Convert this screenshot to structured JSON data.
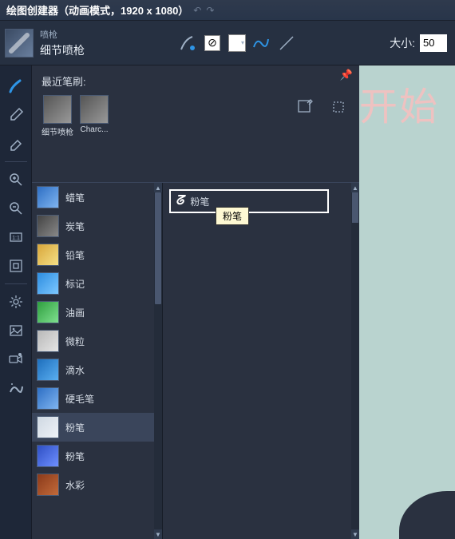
{
  "titlebar": {
    "title": "绘图创建器（动画模式，1920 x 1080）"
  },
  "toolbar": {
    "brush_category": "喷枪",
    "brush_name": "细节喷枪",
    "size_label": "大小:",
    "size_value": "50"
  },
  "panel": {
    "recent_label": "最近笔刷:",
    "recent_items": [
      {
        "name": "细节喷枪"
      },
      {
        "name": "Charc..."
      }
    ]
  },
  "categories": [
    {
      "label": "蜡笔",
      "thumb_bg": "linear-gradient(135deg,#2e6fc4,#7fb4f0)"
    },
    {
      "label": "炭笔",
      "thumb_bg": "linear-gradient(135deg,#444,#888)"
    },
    {
      "label": "铅笔",
      "thumb_bg": "linear-gradient(135deg,#d8a63a,#f5e086)"
    },
    {
      "label": "标记",
      "thumb_bg": "linear-gradient(135deg,#2d8de0,#7cc7ff)"
    },
    {
      "label": "油画",
      "thumb_bg": "linear-gradient(135deg,#2f9f3f,#7fe08f)"
    },
    {
      "label": "微粒",
      "thumb_bg": "linear-gradient(135deg,#b8b8b8,#e5e5e5)"
    },
    {
      "label": "滴水",
      "thumb_bg": "linear-gradient(135deg,#1e6fbd,#5aaef0)"
    },
    {
      "label": "硬毛笔",
      "thumb_bg": "linear-gradient(135deg,#2e6fc4,#7fb4f0)"
    },
    {
      "label": "粉笔",
      "thumb_bg": "linear-gradient(135deg,#cfd8e2,#eef2f7)",
      "selected": true
    },
    {
      "label": "粉笔",
      "thumb_bg": "linear-gradient(135deg,#2e4fc4,#6e8fff)"
    },
    {
      "label": "水彩",
      "thumb_bg": "linear-gradient(135deg,#8b3a1a,#c26a3a)"
    }
  ],
  "current_brush": {
    "label": "粉笔",
    "tooltip": "粉笔"
  },
  "canvas": {
    "bg_text": "开始"
  }
}
